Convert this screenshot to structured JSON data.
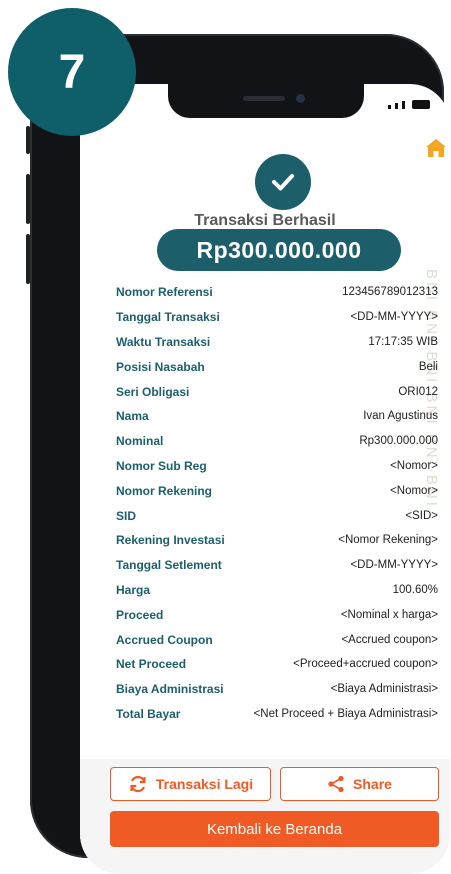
{
  "step_badge": "7",
  "header": {
    "title": "Transaksi Berhasil",
    "amount": "Rp300.000.000"
  },
  "watermark": "BNI BNI BNI BNI BNI BNI",
  "details": [
    {
      "label": "Nomor Referensi",
      "value": "123456789012313"
    },
    {
      "label": "Tanggal Transaksi",
      "value": "<DD-MM-YYYY>"
    },
    {
      "label": "Waktu Transaksi",
      "value": "17:17:35 WIB"
    },
    {
      "label": "Posisi Nasabah",
      "value": "Beli"
    },
    {
      "label": "Seri Obligasi",
      "value": "ORI012"
    },
    {
      "label": "Nama",
      "value": "Ivan Agustinus"
    },
    {
      "label": "Nominal",
      "value": "Rp300.000.000"
    },
    {
      "label": "Nomor Sub Reg",
      "value": "<Nomor>"
    },
    {
      "label": "Nomor Rekening",
      "value": "<Nomor>"
    },
    {
      "label": "SID",
      "value": "<SID>"
    },
    {
      "label": "Rekening Investasi",
      "value": "<Nomor Rekening>"
    },
    {
      "label": "Tanggal Setlement",
      "value": "<DD-MM-YYYY>"
    },
    {
      "label": "Harga",
      "value": "100.60%"
    },
    {
      "label": "Proceed",
      "value": "<Nominal x harga>"
    },
    {
      "label": "Accrued Coupon",
      "value": "<Accrued coupon>"
    },
    {
      "label": "Net Proceed",
      "value": "<Proceed+accrued coupon>"
    },
    {
      "label": "Biaya Administrasi",
      "value": "<Biaya Administrasi>"
    },
    {
      "label": "Total Bayar",
      "value": "<Net Proceed + Biaya Administrasi>"
    }
  ],
  "buttons": {
    "transaksi_lagi": "Transaksi Lagi",
    "share": "Share",
    "kembali": "Kembali ke Beranda"
  },
  "icons": {
    "home": "home-icon",
    "check": "check-icon",
    "refresh": "refresh-icon",
    "share": "share-icon"
  },
  "colors": {
    "primary_teal": "#1c5f6b",
    "accent_orange": "#f05a24",
    "badge": "#0f5f6b"
  }
}
